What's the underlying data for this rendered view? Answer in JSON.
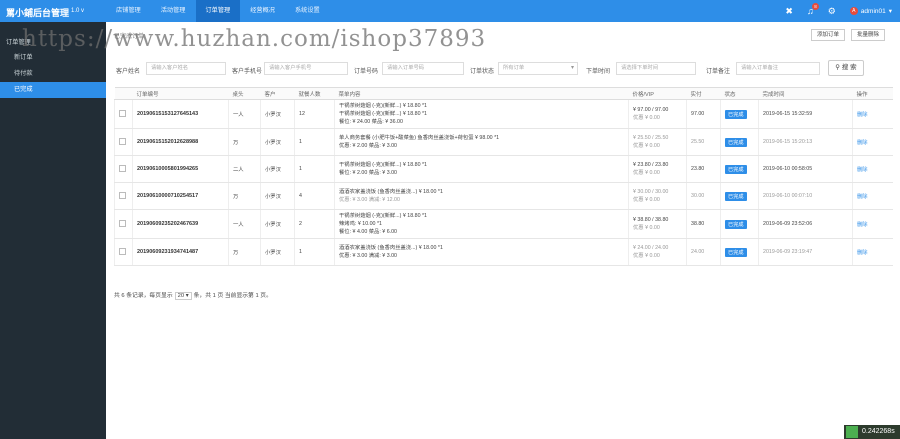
{
  "brand": {
    "title": "罵小鋪后台管理",
    "version": "1.0 v"
  },
  "topnav": [
    "店铺管理",
    "活动管理",
    "订单管理",
    "经营概况",
    "系统设置"
  ],
  "topright": {
    "badge": "8",
    "user": "admin01",
    "user_caret": "▾"
  },
  "sidebar": {
    "head": "订单管理",
    "items": [
      "新订单",
      "待付款",
      "已完成"
    ]
  },
  "watermark": "https://www.huzhan.com/ishop37893",
  "main": {
    "breadcrumb": "已完成订单",
    "add_button": "添加订单",
    "batch_delete_button": "批量删除"
  },
  "filters": {
    "customer_name_label": "客户姓名",
    "customer_name_ph": "请输入客户姓名",
    "customer_phone_label": "客户手机号",
    "customer_phone_ph": "请输入客户手机号",
    "order_no_label": "订单号码",
    "order_no_ph": "请输入订单号码",
    "order_status_label": "订单状态",
    "order_status_value": "所有订单",
    "order_time_label": "下单时间",
    "order_time_ph": "请选择下单时间",
    "order_note_label": "订单备注",
    "order_note_ph": "请输入订单备注",
    "search_button": "搜 索"
  },
  "table": {
    "headers": [
      "订单编号",
      "桌头",
      "客户",
      "就餐人数",
      "菜单内容",
      "价格/VIP",
      "实付",
      "状态",
      "完成时间",
      "操作"
    ],
    "rows": [
      {
        "no": "20190615153127645143",
        "table": "一人",
        "customer": "小罗汉",
        "people": "12",
        "items": [
          "干锅茶树菇烟 (-克)(新鲜...) ¥ 18.80 *1",
          "干锅茶树菇烟 (-克)(新鲜...) ¥ 18.80 *1",
          "餐位: ¥ 24.00 菜品: ¥ 36.00"
        ],
        "price": [
          "¥ 97.00 / 97.00",
          "优惠 ¥ 0.00"
        ],
        "paid": "97.00",
        "status": "已完成",
        "time": "2019-06-15 15:32:59",
        "op": "删除"
      },
      {
        "no": "20190615152012628988",
        "table": "万",
        "customer": "小罗汉",
        "people": "1",
        "items": [
          "单人商务套餐 (小肥牛饭+酸菜鱼) 鱼香肉丝盖浇饭+荷包蛋 ¥ 98.00 *1",
          "优惠: ¥ 2.00 菜品: ¥ 3.00"
        ],
        "price": [
          "¥ 25.50 / 25.50",
          "优惠 ¥ 0.00"
        ],
        "paid": "25.50",
        "status": "已完成",
        "time": "2019-06-15 15:20:13",
        "op": "删除"
      },
      {
        "no": "20190610005801994265",
        "table": "二人",
        "customer": "小罗汉",
        "people": "1",
        "items": [
          "干锅茶树菇烟 (-克)(新鲜...) ¥ 18.80 *1",
          "餐位: ¥ 2.00 菜品: ¥ 3.00"
        ],
        "price": [
          "¥ 23.80 / 23.80",
          "优惠 ¥ 0.00"
        ],
        "paid": "23.80",
        "status": "已完成",
        "time": "2019-06-10 00:58:05",
        "op": "删除"
      },
      {
        "no": "20190610000710254517",
        "table": "万",
        "customer": "小罗汉",
        "people": "4",
        "items": [
          "酒酒农家盖浇饭 (鱼香肉丝盖浇...) ¥ 18.00 *1",
          "优惠: ¥ 3.00 满减: ¥ 12.00"
        ],
        "price": [
          "¥ 30.00 / 30.00",
          "优惠 ¥ 0.00"
        ],
        "paid": "30.00",
        "status": "已完成",
        "time": "2019-06-10 00:07:10",
        "op": "删除"
      },
      {
        "no": "20190609235202467639",
        "table": "一人",
        "customer": "小罗汉",
        "people": "2",
        "items": [
          "干锅茶树菇烟 (-克)(新鲜...) ¥ 18.80 *1",
          "辣烤鸡: ¥ 10.00 *1",
          "餐位: ¥ 4.00 菜品: ¥ 6.00"
        ],
        "price": [
          "¥ 38.80 / 38.80",
          "优惠 ¥ 0.00"
        ],
        "paid": "38.80",
        "status": "已完成",
        "time": "2019-06-09 23:52:06",
        "op": "删除"
      },
      {
        "no": "20190609231934741487",
        "table": "万",
        "customer": "小罗汉",
        "people": "1",
        "items": [
          "酒酒农家盖浇饭 (鱼香肉丝盖浇...) ¥ 18.00 *1",
          "优惠: ¥ 3.00 满减: ¥ 3.00"
        ],
        "price": [
          "¥ 24.00 / 24.00",
          "优惠 ¥ 0.00"
        ],
        "paid": "24.00",
        "status": "已完成",
        "time": "2019-06-09 23:19:47",
        "op": "删除"
      }
    ]
  },
  "pager": {
    "prefix": "共 6 条记录，每页显示",
    "page_size": "20",
    "suffix": "条，共 1 页 当前显示第 1 页。"
  },
  "timer": "0.242268s",
  "colors": {
    "primary": "#2e8ee8",
    "sidebar": "#222d36",
    "active_nav": "#1a6fc7"
  }
}
